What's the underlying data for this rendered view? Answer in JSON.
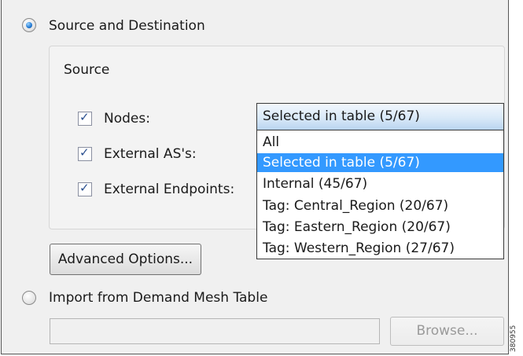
{
  "source_dest": {
    "label": "Source and Destination",
    "selected": true
  },
  "group": {
    "title": "Source"
  },
  "checkboxes": [
    {
      "label": "Nodes:",
      "checked": true
    },
    {
      "label": "External AS's:",
      "checked": true
    },
    {
      "label": "External Endpoints:",
      "checked": true
    }
  ],
  "dropdown": {
    "selected_value": "Selected in table (5/67)",
    "options": [
      "All",
      "Selected in table (5/67)",
      "Internal (45/67)",
      "Tag: Central_Region (20/67)",
      "Tag: Eastern_Region (20/67)",
      "Tag: Western_Region (27/67)"
    ],
    "highlighted_index": 1
  },
  "advanced_button": {
    "label": "Advanced Options..."
  },
  "import_option": {
    "label": "Import from Demand Mesh Table",
    "selected": false
  },
  "file_input": {
    "value": ""
  },
  "browse_button": {
    "label": "Browse..."
  },
  "figure_code": "380955",
  "colors": {
    "highlight": "#3399ff",
    "check": "#2a4f8f"
  }
}
